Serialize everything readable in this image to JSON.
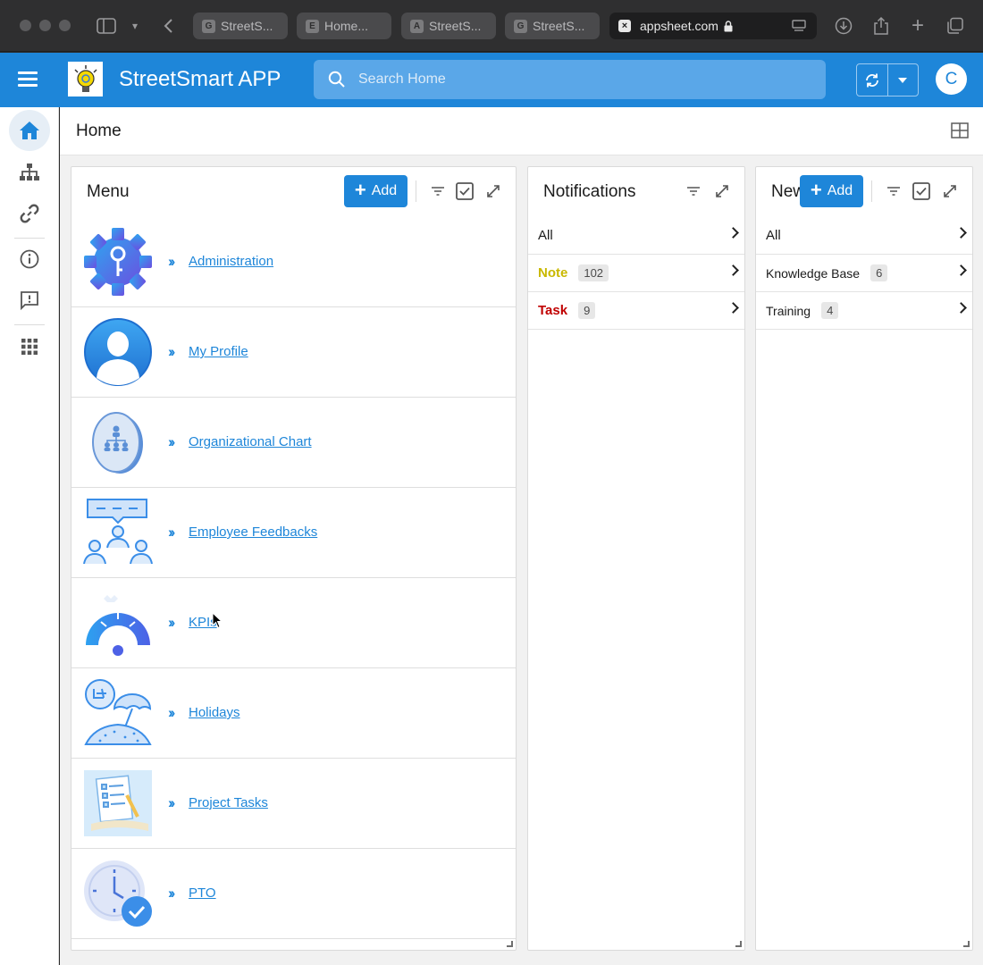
{
  "browser": {
    "tabs": [
      {
        "favicon": "G",
        "label": "StreetS..."
      },
      {
        "favicon": "E",
        "label": "Home..."
      },
      {
        "favicon": "A",
        "label": "StreetS..."
      },
      {
        "favicon": "G",
        "label": "StreetS..."
      }
    ],
    "url": "appsheet.com"
  },
  "app": {
    "title": "StreetSmart APP",
    "search_placeholder": "Search Home",
    "avatar_initial": "C",
    "accent_color": "#1e86d9"
  },
  "rail": {
    "items": [
      {
        "icon": "home-icon",
        "active": true
      },
      {
        "icon": "org-chart-icon"
      },
      {
        "icon": "link-icon"
      },
      {
        "icon": "info-icon"
      },
      {
        "icon": "feedback-icon"
      },
      {
        "icon": "apps-grid-icon"
      }
    ]
  },
  "main": {
    "title": "Home"
  },
  "menu_panel": {
    "title": "Menu",
    "add_label": "Add",
    "items": [
      {
        "label": "Administration",
        "icon": "admin-gear-icon"
      },
      {
        "label": "My Profile",
        "icon": "profile-icon"
      },
      {
        "label": "Organizational Chart",
        "icon": "org-chart-badge-icon"
      },
      {
        "label": "Employee Feedbacks",
        "icon": "feedback-people-icon"
      },
      {
        "label": "KPIs",
        "icon": "gauge-icon"
      },
      {
        "label": "Holidays",
        "icon": "beach-icon"
      },
      {
        "label": "Project Tasks",
        "icon": "clipboard-icon"
      },
      {
        "label": "PTO",
        "icon": "clock-check-icon"
      }
    ]
  },
  "notifications_panel": {
    "title": "Notifications",
    "groups": [
      {
        "label": "All",
        "count": null,
        "color": "#1b1b1b"
      },
      {
        "label": "Note",
        "count": "102",
        "color": "#c9b800"
      },
      {
        "label": "Task",
        "count": "9",
        "color": "#c00000"
      }
    ]
  },
  "news_panel": {
    "title": "New",
    "add_label": "Add",
    "groups": [
      {
        "label": "All",
        "count": null
      },
      {
        "label": "Knowledge Base",
        "count": "6"
      },
      {
        "label": "Training",
        "count": "4"
      }
    ]
  }
}
